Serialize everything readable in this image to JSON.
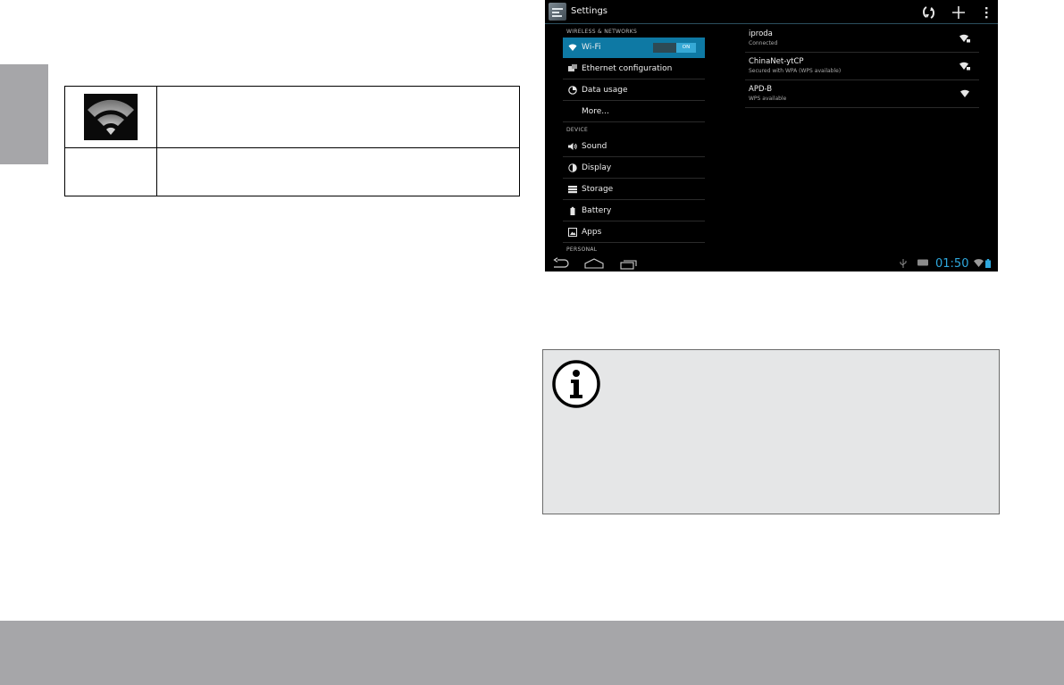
{
  "screen": {
    "title": "Settings",
    "accent_color": "#0e79a4",
    "actions": [
      "wps-icon",
      "add-network-icon",
      "overflow-menu-icon"
    ],
    "sections": {
      "wireless": "WIRELESS & NETWORKS",
      "device": "DEVICE",
      "personal": "PERSONAL"
    },
    "menu": {
      "wifi": "Wi-Fi",
      "wifi_toggle": "ON",
      "ethernet": "Ethernet configuration",
      "data_usage": "Data usage",
      "more": "More...",
      "sound": "Sound",
      "display": "Display",
      "storage": "Storage",
      "battery": "Battery",
      "apps": "Apps"
    },
    "networks": [
      {
        "name": "iproda",
        "status": "Connected",
        "secured": true
      },
      {
        "name": "ChinaNet-ytCP",
        "status": "Secured with WPA (WPS available)",
        "secured": true
      },
      {
        "name": "APD-B",
        "status": "WPS available",
        "secured": false
      }
    ],
    "status_bar": {
      "time": "01:50",
      "time_color": "#2ea8de",
      "icons": [
        "usb-icon",
        "keyboard-icon",
        "wifi-status-icon",
        "battery-icon"
      ]
    }
  },
  "left_table": {
    "icon": "wifi-signal-icon"
  },
  "note": {
    "icon": "info-icon"
  }
}
